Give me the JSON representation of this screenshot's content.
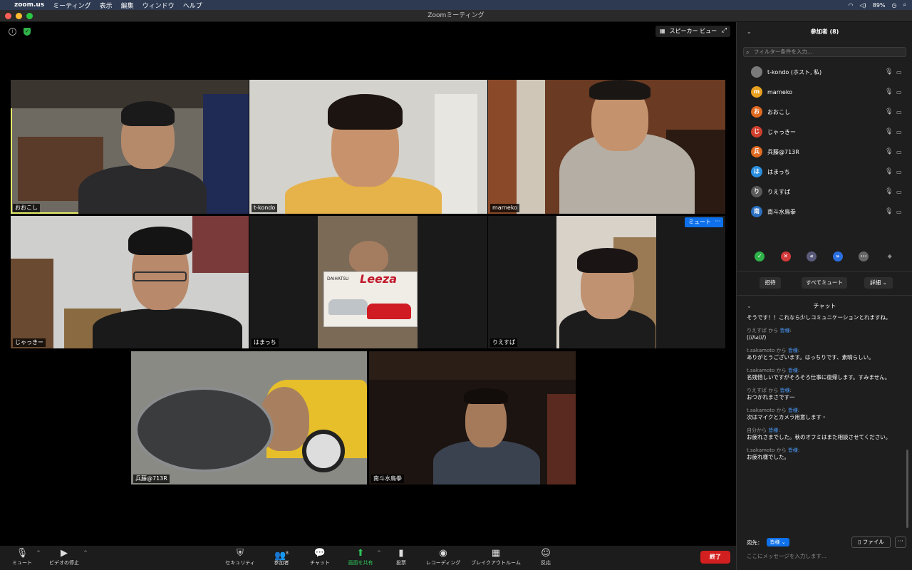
{
  "menubar": {
    "app": "zoom.us",
    "items": [
      "ミーティング",
      "表示",
      "編集",
      "ウィンドウ",
      "ヘルプ"
    ],
    "battery": "89%"
  },
  "window": {
    "title": "Zoomミーティング"
  },
  "view_button": "スピーカー ビュー",
  "tiles": [
    {
      "name": "おおこし"
    },
    {
      "name": "t-kondo"
    },
    {
      "name": "marneko"
    },
    {
      "name": "じゃっきー"
    },
    {
      "name": "はまっち"
    },
    {
      "name": "りえすぱ"
    },
    {
      "name": "兵藤@713R"
    },
    {
      "name": "南斗水鳥拳"
    }
  ],
  "tile_buttons": {
    "mute": "ミュート",
    "more": "···"
  },
  "box_text": {
    "brand": "DAIHATSU",
    "model": "Leeza"
  },
  "toolbar": {
    "mute": "ミュート",
    "video": "ビデオの停止",
    "security": "セキュリティ",
    "participants": "参加者",
    "participants_count": "8",
    "chat": "チャット",
    "share": "画面を共有",
    "poll": "投票",
    "record": "レコーディング",
    "breakout": "ブレイクアウトルーム",
    "reactions": "反応",
    "end": "終了"
  },
  "participants_panel": {
    "title": "参加者 (8)",
    "filter_placeholder": "フィルター条件を入力...",
    "list": [
      {
        "initial": "",
        "name": "t-kondo (ホスト, 私)",
        "color": "#6b6b6b"
      },
      {
        "initial": "m",
        "name": "marneko",
        "color": "#e8a020"
      },
      {
        "initial": "お",
        "name": "おおこし",
        "color": "#e06a20"
      },
      {
        "initial": "じ",
        "name": "じゃっきー",
        "color": "#d0402e"
      },
      {
        "initial": "兵",
        "name": "兵藤@713R",
        "color": "#e06a20"
      },
      {
        "initial": "は",
        "name": "はまっち",
        "color": "#2a8fe0"
      },
      {
        "initial": "り",
        "name": "りえすぱ",
        "color": "#5a5a5a"
      },
      {
        "initial": "南",
        "name": "南斗水鳥拳",
        "color": "#2a6fc0"
      }
    ],
    "buttons": {
      "invite": "招待",
      "mute_all": "すべてミュート",
      "more": "詳細"
    }
  },
  "chat_panel": {
    "title": "チャット",
    "messages": [
      {
        "from": "",
        "to": "",
        "text": "そうです！！これなら少しコミュニケーションとれますね。"
      },
      {
        "from": "りえすぱ から",
        "to": "皆様",
        "text": "(///ω///)"
      },
      {
        "from": "t.sakamoto から",
        "to": "皆様",
        "text": "ありがとうございます。はっちりです、素晴らしい。"
      },
      {
        "from": "t.sakamoto から",
        "to": "皆様",
        "text": "名残惜しいですがそろそろ仕事に復帰します。すみません。"
      },
      {
        "from": "りえすぱ から",
        "to": "皆様",
        "text": "おつかれまさです一"
      },
      {
        "from": "t.sakamoto から",
        "to": "皆様",
        "text": "次はマイクとカメラ用意します・"
      },
      {
        "from": "自分から",
        "to": "皆様",
        "text": "お疲れさまでした。秋のオフミはまた相談させてください。"
      },
      {
        "from": "t.sakamoto から",
        "to": "皆様",
        "text": "お疲れ様でした。"
      }
    ],
    "send_to_label": "宛先：",
    "send_to_value": "皆様",
    "file_button": "ファイル",
    "input_placeholder": "ここにメッセージを入力します..."
  }
}
